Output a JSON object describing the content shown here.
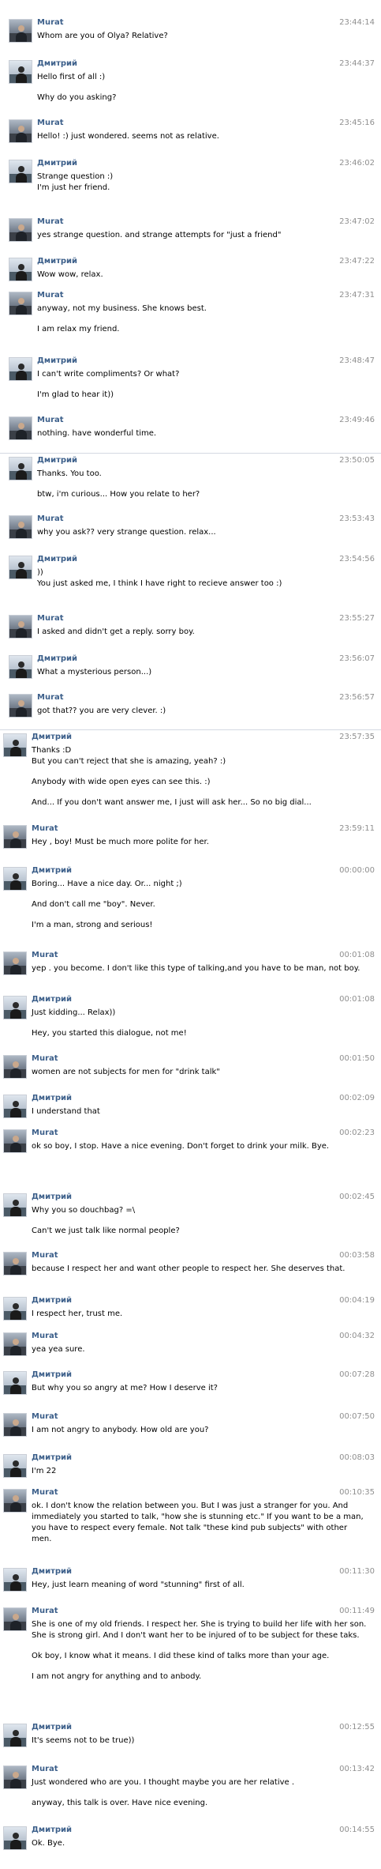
{
  "messages": [
    {
      "author": "Murat",
      "time": "23:44:14",
      "paragraphs": [
        "Whom are you of Olya? Relative?"
      ]
    },
    {
      "author": "Дмитрий",
      "time": "23:44:37",
      "paragraphs": [
        "Hello first of all :)",
        "Why do you asking?"
      ]
    },
    {
      "author": "Murat",
      "time": "23:45:16",
      "paragraphs": [
        "Hello! :) just wondered. seems not as relative."
      ]
    },
    {
      "author": "Дмитрий",
      "time": "23:46:02",
      "paragraphs": [
        "Strange question :)\nI'm just her friend."
      ]
    },
    {
      "author": "Murat",
      "time": "23:47:02",
      "paragraphs": [
        "yes strange question. and strange attempts for \"just a friend\""
      ]
    },
    {
      "author": "Дмитрий",
      "time": "23:47:22",
      "paragraphs": [
        "Wow wow, relax."
      ]
    },
    {
      "author": "Murat",
      "time": "23:47:31",
      "paragraphs": [
        "anyway, not my business. She knows best.",
        "I am relax my friend."
      ]
    },
    {
      "author": "Дмитрий",
      "time": "23:48:47",
      "paragraphs": [
        "I can't write compliments? Or what?",
        "I'm glad to hear it))"
      ]
    },
    {
      "author": "Murat",
      "time": "23:49:46",
      "paragraphs": [
        "nothing. have wonderful time."
      ]
    },
    {
      "author": "Дмитрий",
      "time": "23:50:05",
      "paragraphs": [
        "Thanks. You too.",
        "btw, i'm curious... How you relate to her?"
      ]
    },
    {
      "author": "Murat",
      "time": "23:53:43",
      "paragraphs": [
        "why you ask?? very strange question. relax..."
      ]
    },
    {
      "author": "Дмитрий",
      "time": "23:54:56",
      "paragraphs": [
        "))\nYou just asked me, I think I have right to recieve answer too :)"
      ]
    },
    {
      "author": "Murat",
      "time": "23:55:27",
      "paragraphs": [
        "I asked and didn't get a reply. sorry boy."
      ]
    },
    {
      "author": "Дмитрий",
      "time": "23:56:07",
      "paragraphs": [
        "What a mysterious person...)"
      ]
    },
    {
      "author": "Murat",
      "time": "23:56:57",
      "paragraphs": [
        "got that?? you are very clever. :)"
      ]
    },
    {
      "author": "Дмитрий",
      "time": "23:57:35",
      "paragraphs": [
        "Thanks :D\nBut you can't reject that she is amazing, yeah? :)",
        "Anybody with wide open eyes can see this. :)",
        "And... If you don't want answer me, I just will ask her... So no big dial..."
      ]
    },
    {
      "author": "Murat",
      "time": "23:59:11",
      "paragraphs": [
        "Hey , boy! Must be much more polite for her."
      ]
    },
    {
      "author": "Дмитрий",
      "time": "00:00:00",
      "paragraphs": [
        "Boring... Have a nice day. Or... night ;)",
        "And don't call me \"boy\". Never.",
        "I'm a man, strong and serious!"
      ]
    },
    {
      "author": "Murat",
      "time": "00:01:08",
      "paragraphs": [
        "yep . you become. I don't like this type of talking,and you have to be man, not boy."
      ]
    },
    {
      "author": "Дмитрий",
      "time": "00:01:08",
      "paragraphs": [
        "Just kidding... Relax))",
        "Hey, you started this dialogue, not me!"
      ]
    },
    {
      "author": "Murat",
      "time": "00:01:50",
      "paragraphs": [
        "women are not subjects for men for \"drink talk\""
      ]
    },
    {
      "author": "Дмитрий",
      "time": "00:02:09",
      "paragraphs": [
        "I understand that"
      ]
    },
    {
      "author": "Murat",
      "time": "00:02:23",
      "paragraphs": [
        "ok so boy, I stop. Have a nice evening. Don't forget to drink your milk. Bye."
      ]
    },
    {
      "author": "Дмитрий",
      "time": "00:02:45",
      "paragraphs": [
        "Why you so douchbag? =\\",
        "Can't we just talk like normal people?"
      ]
    },
    {
      "author": "Murat",
      "time": "00:03:58",
      "paragraphs": [
        "because I respect her and want other people to respect her. She deserves that."
      ]
    },
    {
      "author": "Дмитрий",
      "time": "00:04:19",
      "paragraphs": [
        "I respect her, trust me."
      ]
    },
    {
      "author": "Murat",
      "time": "00:04:32",
      "paragraphs": [
        "yea yea sure."
      ]
    },
    {
      "author": "Дмитрий",
      "time": "00:07:28",
      "paragraphs": [
        "But why you so angry at me? How I deserve it?"
      ]
    },
    {
      "author": "Murat",
      "time": "00:07:50",
      "paragraphs": [
        "I am not angry to anybody. How old are you?"
      ]
    },
    {
      "author": "Дмитрий",
      "time": "00:08:03",
      "paragraphs": [
        "I'm 22"
      ]
    },
    {
      "author": "Murat",
      "time": "00:10:35",
      "paragraphs": [
        "ok. I don't know the relation between you. But I was just a stranger for you. And immediately you started to talk, \"how she is stunning etc.\" If you want to be a man, you have to respect every female. Not talk \"these kind pub subjects\" with other men."
      ]
    },
    {
      "author": "Дмитрий",
      "time": "00:11:30",
      "paragraphs": [
        "Hey, just learn meaning of word \"stunning\" first of all."
      ]
    },
    {
      "author": "Murat",
      "time": "00:11:49",
      "paragraphs": [
        "She is one of my old friends. I respect her. She is trying to build her life with her son. She is strong girl. And I don't want her to be injured of to be subject for these taks.",
        "Ok boy, I know what it means. I did these kind of talks more than your age.",
        "I am not angry for anything and to anbody."
      ]
    },
    {
      "author": "Дмитрий",
      "time": "00:12:55",
      "paragraphs": [
        "It's seems not to be true))"
      ]
    },
    {
      "author": "Murat",
      "time": "00:13:42",
      "paragraphs": [
        "Just wondered who are you. I thought maybe you are her relative .",
        "anyway, this talk is over. Have nice evening."
      ]
    },
    {
      "author": "Дмитрий",
      "time": "00:14:55",
      "paragraphs": [
        "Ok. Bye."
      ]
    }
  ]
}
